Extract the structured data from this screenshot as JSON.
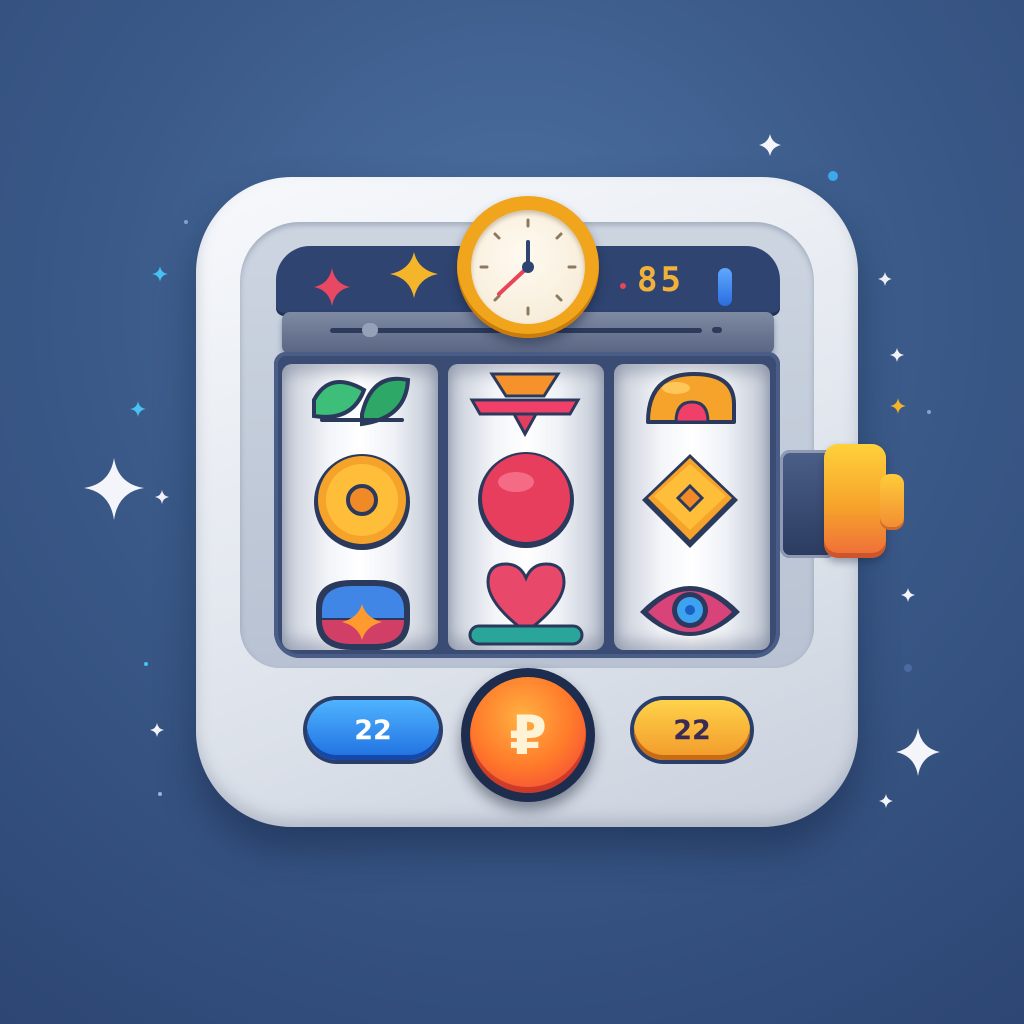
{
  "machine": {
    "counter_value": "85",
    "bet_left_value": "22",
    "bet_right_value": "22",
    "spin_symbol": "₽"
  },
  "reels": [
    {
      "symbols": [
        "leaf-icon",
        "coin-ring-icon",
        "gem-dome-icon"
      ]
    },
    {
      "symbols": [
        "tray-icon",
        "red-orb-icon",
        "heart-icon"
      ]
    },
    {
      "symbols": [
        "orange-dome-icon",
        "diamond-coin-icon",
        "eye-gem-icon"
      ]
    }
  ],
  "colors": {
    "background": "#3b5a89",
    "header": "#2f4470",
    "accent_orange": "#f6a32b",
    "accent_blue": "#1f6fe0",
    "accent_red": "#f0363e"
  }
}
